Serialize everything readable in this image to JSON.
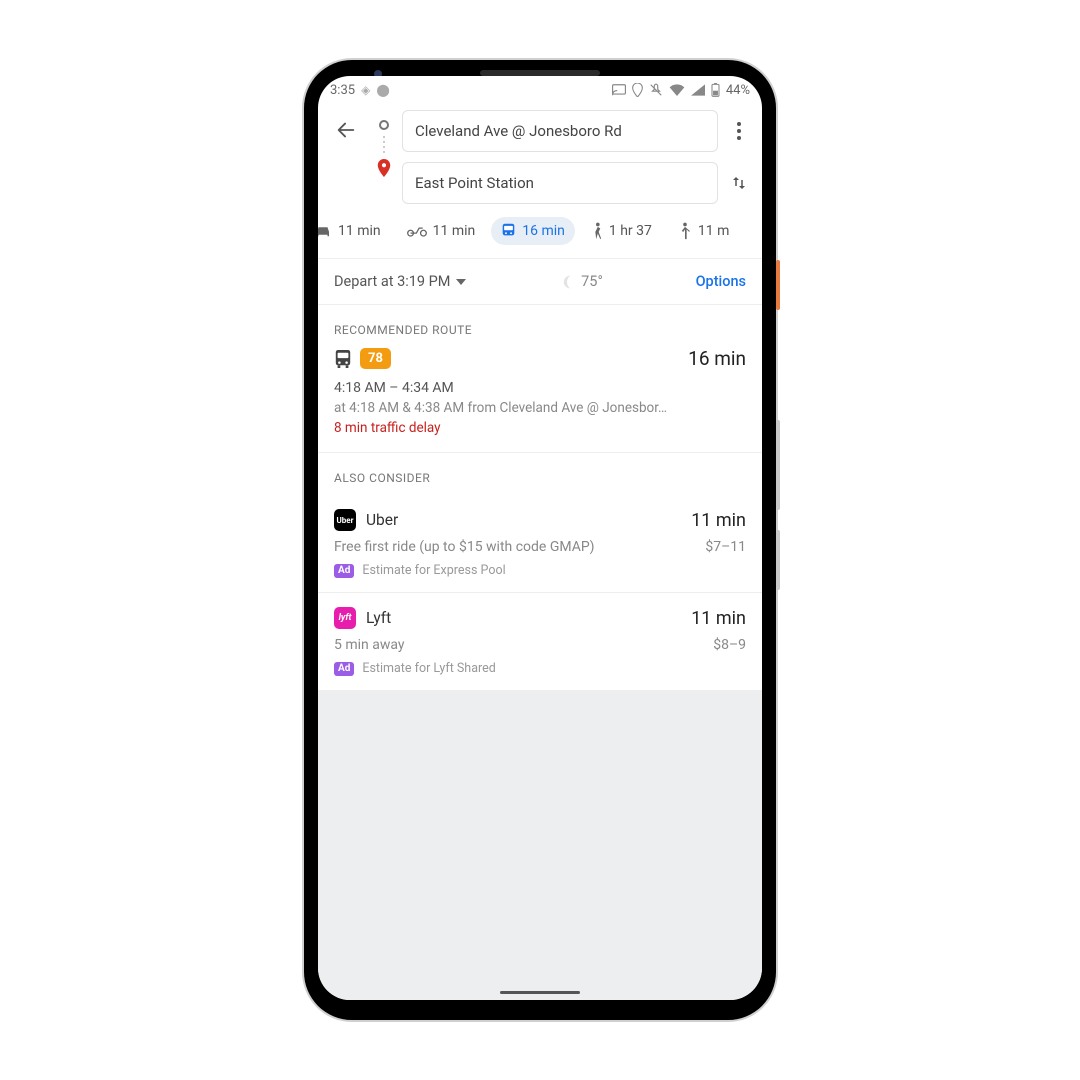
{
  "status": {
    "time": "3:35",
    "battery": "44%"
  },
  "header": {
    "origin": "Cleveland Ave @ Jonesboro Rd",
    "destination": "East Point Station"
  },
  "modes": {
    "car": "11 min",
    "motorcycle": "11 min",
    "transit": "16 min",
    "walk": "1 hr 37",
    "rideshare": "11 m"
  },
  "subbar": {
    "depart": "Depart at 3:19 PM",
    "temp": "75°",
    "options": "Options"
  },
  "recommended": {
    "label": "RECOMMENDED ROUTE",
    "route_number": "78",
    "duration": "16 min",
    "time_range": "4:18 AM – 4:34 AM",
    "detail": "at 4:18 AM & 4:38 AM from Cleveland Ave @ Jonesbor…",
    "delay": "8 min traffic delay"
  },
  "also": {
    "label": "ALSO CONSIDER",
    "uber": {
      "name": "Uber",
      "duration": "11 min",
      "promo": "Free first ride (up to $15 with code GMAP)",
      "price": "$7–11",
      "ad_label": "Ad",
      "ad_text": "Estimate for Express Pool"
    },
    "lyft": {
      "name": "Lyft",
      "duration": "11 min",
      "eta": "5 min away",
      "price": "$8–9",
      "ad_label": "Ad",
      "ad_text": "Estimate for Lyft Shared"
    }
  }
}
